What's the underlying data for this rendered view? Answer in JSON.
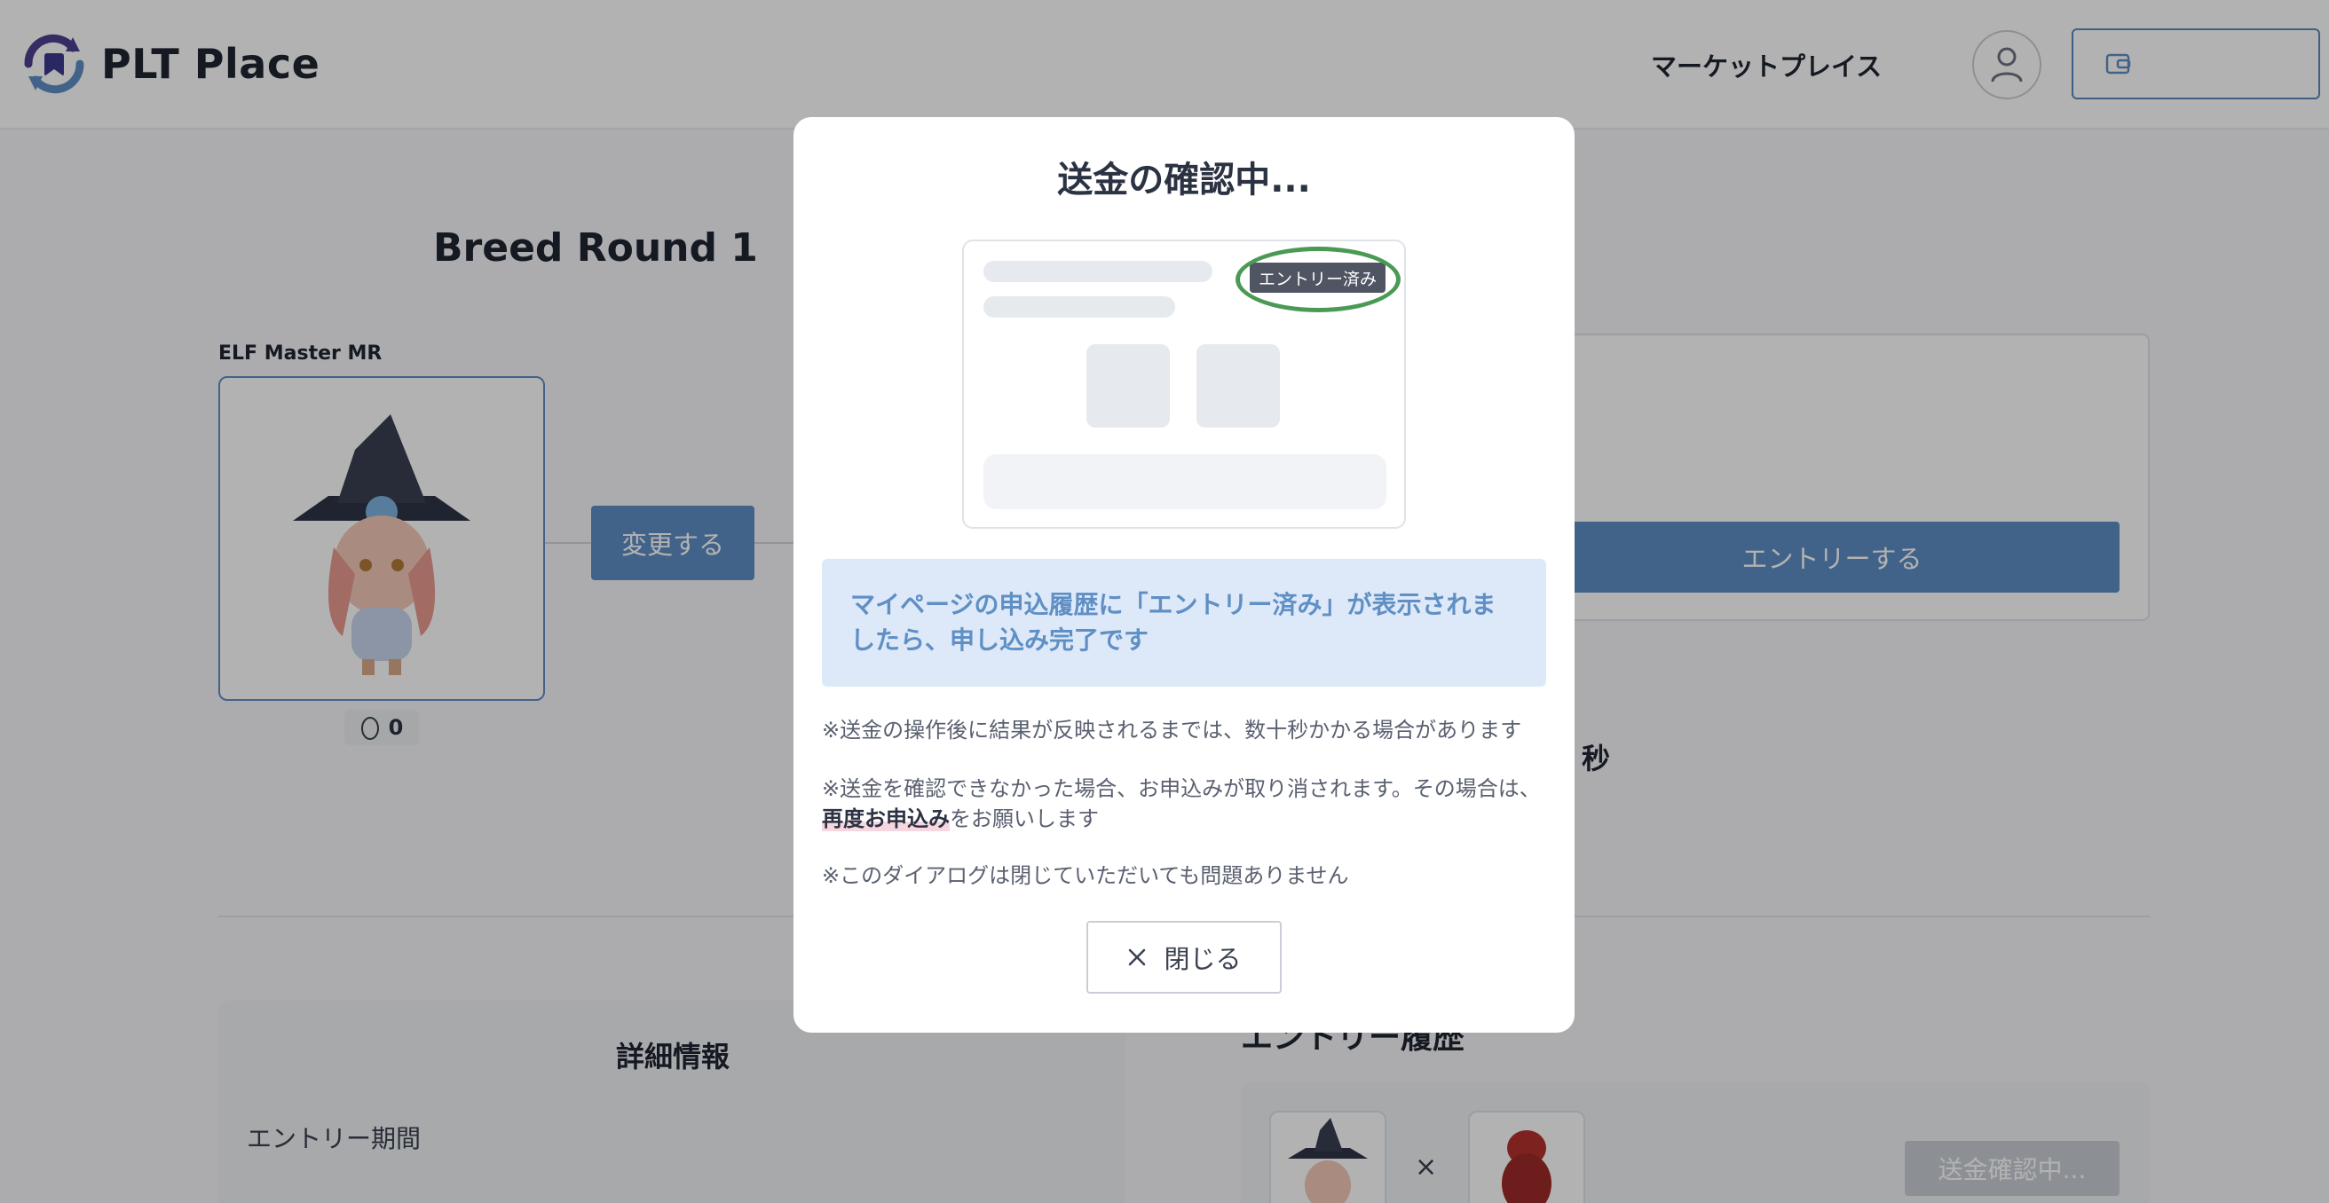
{
  "header": {
    "brand": "PLT Place",
    "nav_marketplace": "マーケットプレイス"
  },
  "page": {
    "breed_title": "Breed Round 1",
    "elf_label": "ELF Master MR",
    "egg_count": "0",
    "change_button": "変更する",
    "entry_button": "エントリーする",
    "seconds_suffix": "秒",
    "detail_title": "詳細情報",
    "entry_period_label": "エントリー期間",
    "history_title": "エントリー履歴",
    "times_symbol": "×",
    "confirming_button": "送金確認中..."
  },
  "modal": {
    "title": "送金の確認中...",
    "badge": "エントリー済み",
    "info": "マイページの申込履歴に「エントリー済み」が表示されましたら、申し込み完了です",
    "note1": "※送金の操作後に結果が反映されるまでは、数十秒かかる場合があります",
    "note2_prefix": "※送金を確認できなかった場合、お申込みが取り消されます。その場合は、",
    "note2_strong": "再度お申込み",
    "note2_suffix": "をお願いします",
    "note3": "※このダイアログは閉じていただいても問題ありません",
    "close_button": "閉じる"
  },
  "colors": {
    "accent": "#5f8fc4",
    "brand_purple": "#4b3f8f",
    "success_ring": "#4a9a55"
  },
  "icons": {
    "logo": "plt-logo-icon",
    "user": "user-icon",
    "wallet": "wallet-icon",
    "egg": "egg-icon",
    "close": "close-icon"
  }
}
